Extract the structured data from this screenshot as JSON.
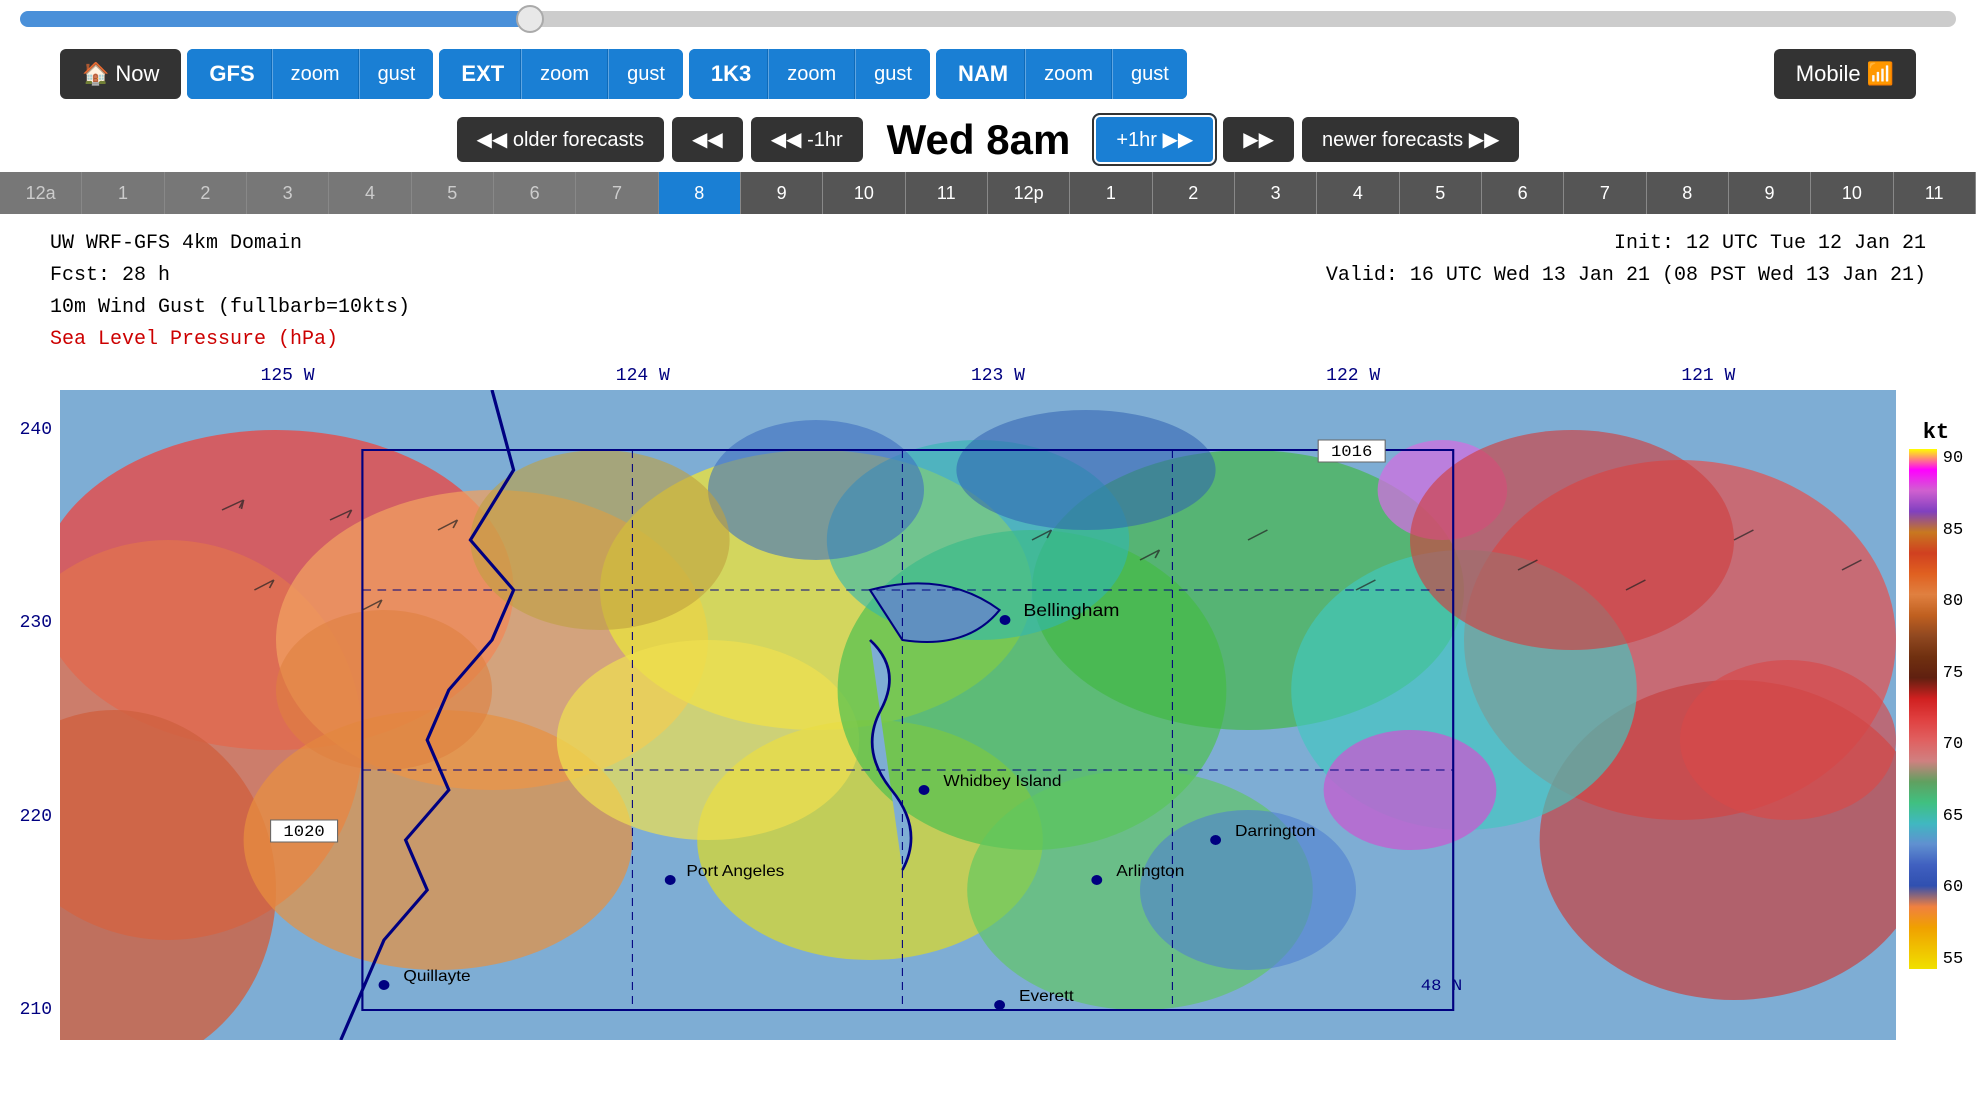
{
  "slider": {
    "value": 26,
    "min": 0,
    "max": 100
  },
  "nav": {
    "now_label": "Now",
    "models": [
      {
        "name": "GFS",
        "zoom": "zoom",
        "gust": "gust"
      },
      {
        "name": "EXT",
        "zoom": "zoom",
        "gust": "gust"
      },
      {
        "name": "1K3",
        "zoom": "zoom",
        "gust": "gust"
      },
      {
        "name": "NAM",
        "zoom": "zoom",
        "gust": "gust"
      }
    ],
    "mobile_label": "Mobile"
  },
  "forecast": {
    "older_label": "◀◀ older forecasts",
    "back2_label": "◀◀",
    "back1hr_label": "◀◀ -1hr",
    "current_time": "Wed 8am",
    "forward1hr_label": "+1hr ▶▶",
    "forward2_label": "▶▶",
    "newer_label": "newer forecasts ▶▶"
  },
  "timeline": {
    "hours": [
      "12a",
      "1",
      "2",
      "3",
      "4",
      "5",
      "6",
      "7",
      "8",
      "9",
      "10",
      "11",
      "12p",
      "1",
      "2",
      "3",
      "4",
      "5",
      "6",
      "7",
      "8",
      "9",
      "10",
      "11"
    ],
    "active_index": 8
  },
  "map_info": {
    "model": "UW WRF-GFS 4km Domain",
    "fcst": "Fcst:    28 h",
    "wind": "10m Wind Gust (fullbarb=10kts)",
    "sea_level": "Sea Level Pressure (hPa)",
    "init": "Init: 12 UTC Tue 12 Jan 21",
    "valid": "Valid: 16 UTC Wed 13 Jan 21 (08 PST Wed 13 Jan 21)"
  },
  "map": {
    "lon_labels": [
      "125 W",
      "124 W",
      "123 W",
      "122 W",
      "121 W"
    ],
    "lat_labels": [
      "240",
      "230",
      "220",
      "210"
    ],
    "cities": [
      "Bellingham",
      "Quillayte",
      "Port Angeles",
      "Whidbey Island",
      "Arlington",
      "Darrington",
      "Everett"
    ],
    "pressure_labels": [
      "1016",
      "1020"
    ],
    "scale_kt_label": "kt",
    "scale_values": [
      "90",
      "85",
      "80",
      "75",
      "70",
      "65",
      "60",
      "55"
    ]
  },
  "colors": {
    "accent_blue": "#1a7fd4",
    "dark_btn": "#333333",
    "timeline_bg": "#555555",
    "active_timeline": "#1a7fd4"
  }
}
